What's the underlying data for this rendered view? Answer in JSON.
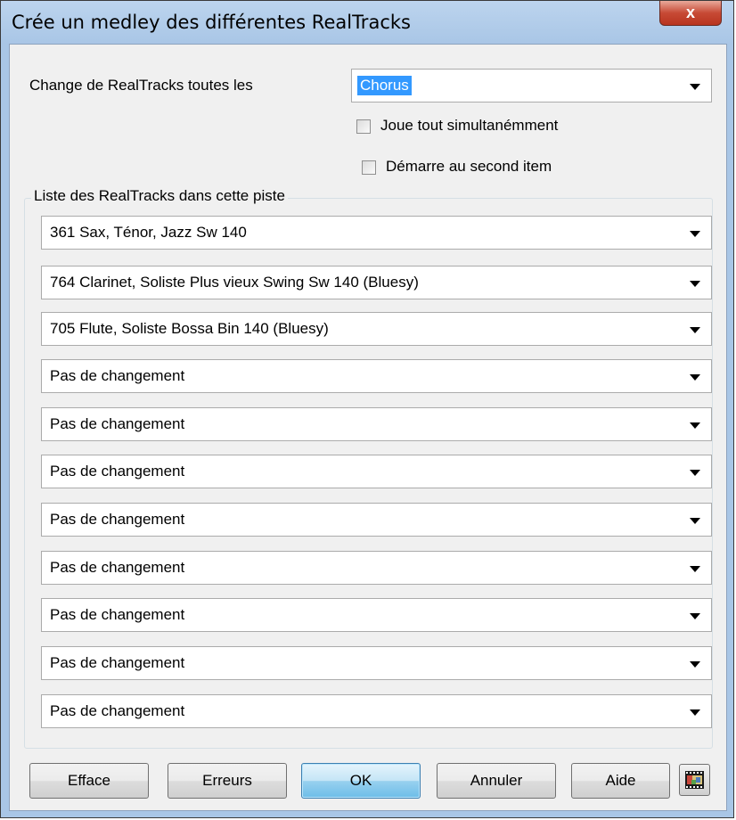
{
  "window": {
    "title": "Crée un medley des différentes RealTracks",
    "close_label": "x"
  },
  "change": {
    "label": "Change de RealTracks toutes les",
    "value": "Chorus"
  },
  "options": {
    "play_all_label": "Joue tout simultanémment",
    "play_all_checked": false,
    "start_second_label": "Démarre au second item",
    "start_second_checked": false
  },
  "list": {
    "group_label": "Liste des RealTracks dans cette piste",
    "items": [
      "361 Sax, Ténor, Jazz Sw 140",
      "764 Clarinet, Soliste Plus vieux Swing Sw 140  (Bluesy)",
      "705 Flute, Soliste Bossa Bin 140  (Bluesy)",
      "Pas de changement",
      "Pas de changement",
      "Pas de changement",
      "Pas de changement",
      "Pas de changement",
      "Pas de changement",
      "Pas de changement",
      "Pas de changement"
    ]
  },
  "buttons": {
    "clear": "Efface",
    "errors": "Erreurs",
    "ok": "OK",
    "cancel": "Annuler",
    "help": "Aide"
  },
  "icons": {
    "close": "close-icon",
    "dropdown": "chevron-down-icon",
    "extra": "film-icon"
  }
}
